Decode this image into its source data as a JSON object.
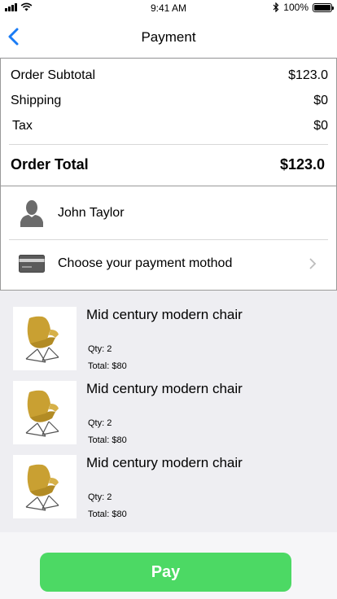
{
  "status_bar": {
    "time": "9:41 AM",
    "battery_text": "100%",
    "battery_level": 1.0
  },
  "nav": {
    "title": "Payment",
    "back_icon": "chevron-left-icon"
  },
  "summary": {
    "rows": [
      {
        "label": "Order Subtotal",
        "value": "$123.0"
      },
      {
        "label": "Shipping",
        "value": "$0"
      },
      {
        "label": "Tax",
        "value": "$0"
      }
    ],
    "total_label": "Order Total",
    "total_value": "$123.0"
  },
  "customer": {
    "name": "John Taylor",
    "icon": "person-icon"
  },
  "payment": {
    "label": "Choose your payment mothod",
    "icon": "credit-card-icon",
    "chevron": "chevron-right-icon"
  },
  "items": [
    {
      "title": "Mid century modern chair",
      "qty": "Qty: 2",
      "total": "Total: $80"
    },
    {
      "title": "Mid century modern chair",
      "qty": "Qty: 2",
      "total": "Total: $80"
    },
    {
      "title": "Mid century modern chair",
      "qty": "Qty: 2",
      "total": "Total: $80"
    }
  ],
  "pay_button": {
    "label": "Pay",
    "color": "#4cd964"
  },
  "colors": {
    "accent": "#1a7cf5",
    "chair": "#c9a032"
  }
}
